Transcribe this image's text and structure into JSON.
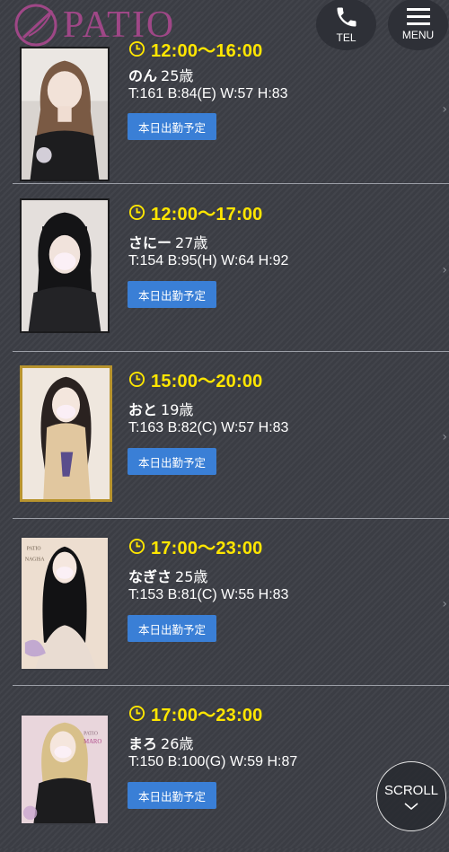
{
  "header": {
    "logo_text": "PATIO",
    "tel_label": "TEL",
    "menu_label": "MENU"
  },
  "colors": {
    "time": "#ffe600",
    "button": "#3a7fd6",
    "background": "#3b3d44"
  },
  "schedule": [
    {
      "time": "12:00〜16:00",
      "name": "のん",
      "age": "25歳",
      "measures": "T:161 B:84(E) W:57 H:83",
      "button": "本日出勤予定"
    },
    {
      "time": "12:00〜17:00",
      "name": "さにー",
      "age": "27歳",
      "measures": "T:154 B:95(H) W:64 H:92",
      "button": "本日出勤予定"
    },
    {
      "time": "15:00〜20:00",
      "name": "おと",
      "age": "19歳",
      "measures": "T:163 B:82(C) W:57 H:83",
      "button": "本日出勤予定"
    },
    {
      "time": "17:00〜23:00",
      "name": "なぎさ",
      "age": "25歳",
      "measures": "T:153 B:81(C) W:55 H:83",
      "button": "本日出勤予定"
    },
    {
      "time": "17:00〜23:00",
      "name": "まろ",
      "age": "26歳",
      "measures": "T:150 B:100(G) W:59 H:87",
      "button": "本日出勤予定"
    }
  ],
  "photo_captions": {
    "nagisa_brand": "PATIO",
    "nagisa_name": "NAGISA",
    "maro_brand": "PATIO",
    "maro_name": "MARO"
  },
  "scroll_label": "SCROLL"
}
